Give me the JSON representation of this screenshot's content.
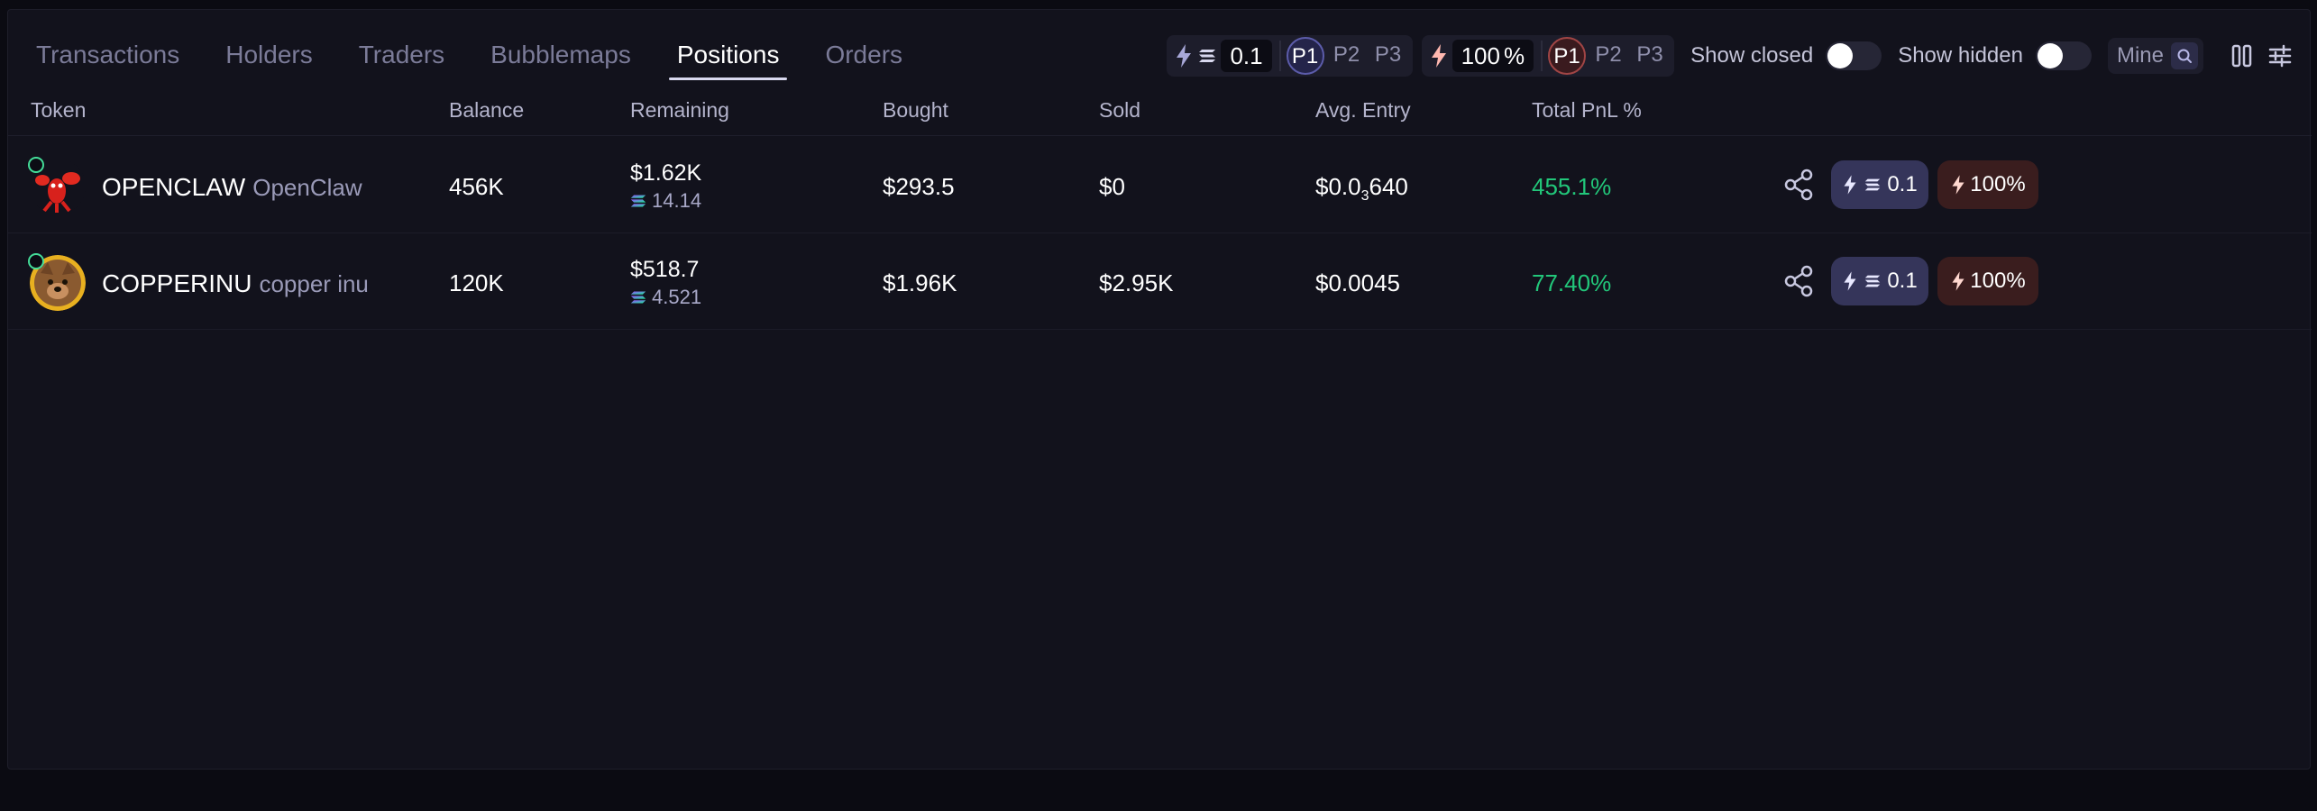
{
  "tabs": [
    {
      "label": "Transactions"
    },
    {
      "label": "Holders"
    },
    {
      "label": "Traders"
    },
    {
      "label": "Bubblemaps"
    },
    {
      "label": "Positions",
      "active": true
    },
    {
      "label": "Orders"
    }
  ],
  "toolbar": {
    "buy_amount": "0.1",
    "buy_presets": [
      "P1",
      "P2",
      "P3"
    ],
    "sell_percent": "100",
    "sell_unit": "%",
    "sell_presets": [
      "P1",
      "P2",
      "P3"
    ],
    "show_closed_label": "Show closed",
    "show_hidden_label": "Show hidden",
    "mine_label": "Mine"
  },
  "table": {
    "headers": {
      "token": "Token",
      "balance": "Balance",
      "remaining": "Remaining",
      "bought": "Bought",
      "sold": "Sold",
      "avg_entry": "Avg. Entry",
      "total_pnl": "Total PnL %"
    },
    "rows": [
      {
        "symbol": "OPENCLAW",
        "name": "OpenClaw",
        "balance": "456K",
        "remaining_usd": "$1.62K",
        "remaining_sol": "14.14",
        "bought": "$293.5",
        "sold": "$0",
        "avg_entry_prefix": "$0.0",
        "avg_entry_zeros": "3",
        "avg_entry_digits": "640",
        "total_pnl": "455.1%",
        "quick_buy": "0.1",
        "quick_sell": "100%"
      },
      {
        "symbol": "COPPERINU",
        "name": "copper inu",
        "balance": "120K",
        "remaining_usd": "$518.7",
        "remaining_sol": "4.521",
        "bought": "$1.96K",
        "sold": "$2.95K",
        "avg_entry": "$0.0045",
        "total_pnl": "77.40%",
        "quick_buy": "0.1",
        "quick_sell": "100%"
      }
    ]
  },
  "colors": {
    "background": "#12121c",
    "pnl_positive": "#22c77a",
    "buy_accent": "#35355a",
    "sell_accent": "#3a1d1e"
  }
}
